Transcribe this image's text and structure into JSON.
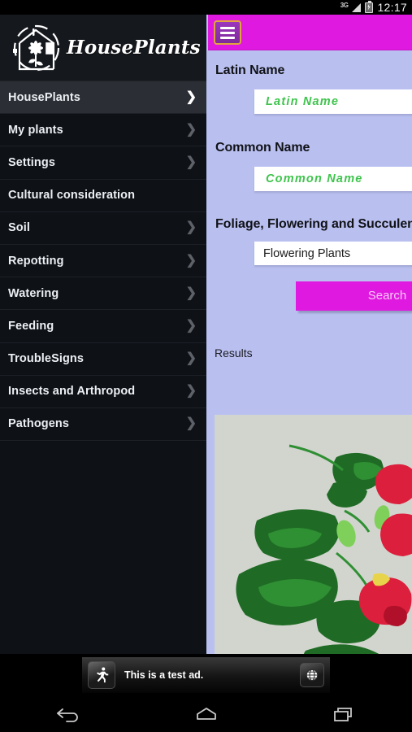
{
  "statusbar": {
    "network": "3G",
    "time": "12:17",
    "signal_icon": "signal-bars-icon",
    "battery_icon": "battery-charging-icon"
  },
  "sidebar": {
    "brand": "HousePlants",
    "logo_icon": "houseplants-logo-icon",
    "items": [
      {
        "label": "HousePlants",
        "selected": true,
        "chevron": true
      },
      {
        "label": "My plants",
        "selected": false,
        "chevron": true
      },
      {
        "label": "Settings",
        "selected": false,
        "chevron": true
      },
      {
        "label": "Cultural consideration",
        "selected": false,
        "chevron": false
      },
      {
        "label": "Soil",
        "selected": false,
        "chevron": true
      },
      {
        "label": "Repotting",
        "selected": false,
        "chevron": true
      },
      {
        "label": "Watering",
        "selected": false,
        "chevron": true
      },
      {
        "label": "Feeding",
        "selected": false,
        "chevron": true
      },
      {
        "label": "TroubleSigns",
        "selected": false,
        "chevron": true
      },
      {
        "label": "Insects and Arthropod",
        "selected": false,
        "chevron": true
      },
      {
        "label": "Pathogens",
        "selected": false,
        "chevron": true
      }
    ]
  },
  "topbar": {
    "menu_icon": "hamburger-menu-icon"
  },
  "form": {
    "latin_label": "Latin Name",
    "latin_placeholder": "Latin Name",
    "latin_value": "",
    "common_label": "Common Name",
    "common_placeholder": "Common Name",
    "common_value": "",
    "type_label": "Foliage, Flowering and Succulent",
    "type_selected": "Flowering Plants",
    "type_options": [
      "Flowering Plants"
    ],
    "search_label": "Search"
  },
  "results": {
    "label": "Results",
    "image_alt": "flowering-plant-photo"
  },
  "ad": {
    "text": "This is a test ad.",
    "icon": "running-person-icon",
    "action_icon": "globe-icon"
  },
  "navbar": {
    "back": "back-icon",
    "home": "home-icon",
    "recents": "recents-icon"
  },
  "colors": {
    "accent_magenta": "#e019e0",
    "panel_background": "#b9c0f0",
    "sidebar_background": "#0e1116",
    "placeholder_green": "#3fc44d",
    "menu_border_gold": "#e0a63c"
  }
}
